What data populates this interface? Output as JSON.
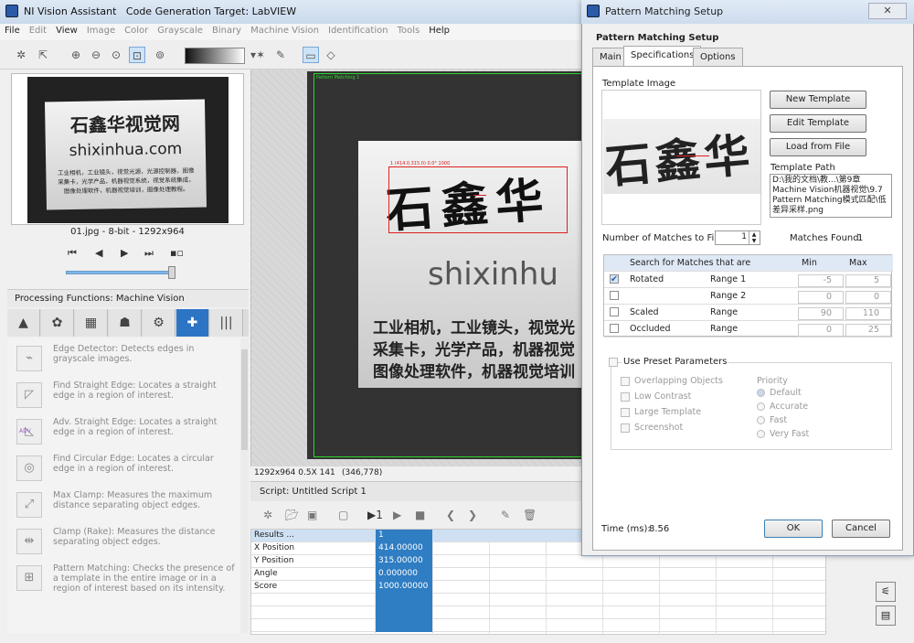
{
  "window": {
    "title": "NI Vision Assistant",
    "subtitle": "Code Generation Target: LabVIEW"
  },
  "menu": [
    {
      "label": "File",
      "dim": false
    },
    {
      "label": "Edit",
      "dim": true
    },
    {
      "label": "View",
      "dim": false
    },
    {
      "label": "Image",
      "dim": true
    },
    {
      "label": "Color",
      "dim": true
    },
    {
      "label": "Grayscale",
      "dim": true
    },
    {
      "label": "Binary",
      "dim": true
    },
    {
      "label": "Machine Vision",
      "dim": true
    },
    {
      "label": "Identification",
      "dim": true
    },
    {
      "label": "Tools",
      "dim": true
    },
    {
      "label": "Help",
      "dim": false
    }
  ],
  "thumbnail": {
    "card_line1": "石鑫华视觉网",
    "card_line2": "shixinhua.com",
    "card_line3": "工业相机，工业镜头，视觉光源，光源控制器，图像",
    "card_line4": "采集卡，光学产品，机器视觉系统，视觉系统集成，",
    "card_line5": "图像处理软件，机器视觉培训，图像处理教程。",
    "info": "01.jpg - 8-bit - 1292x964"
  },
  "processing": {
    "title": "Processing Functions: Machine Vision",
    "items": [
      {
        "title": "Edge Detector:",
        "desc": "Detects edges in grayscale images.",
        "icon": "edge-icon"
      },
      {
        "title": "Find Straight Edge:",
        "desc": "Locates a straight edge in a region of interest.",
        "icon": "straight-edge-icon"
      },
      {
        "title": "Adv. Straight Edge:",
        "desc": "Locates a straight edge in a region of interest.",
        "icon": "adv-edge-icon",
        "badge": "ADV"
      },
      {
        "title": "Find Circular Edge:",
        "desc": "Locates a circular edge in a region of interest.",
        "icon": "circle-edge-icon"
      },
      {
        "title": "Max Clamp:",
        "desc": "Measures the maximum distance separating object edges.",
        "icon": "clamp-icon"
      },
      {
        "title": "Clamp (Rake):",
        "desc": "Measures the distance separating object edges.",
        "icon": "rake-icon"
      },
      {
        "title": "Pattern Matching:",
        "desc": "Checks the presence of a template in the entire image or in a region of interest based on its intensity.",
        "icon": "pattern-icon"
      }
    ]
  },
  "viewer": {
    "roi_label": "Pattern Matching 1",
    "match_label": "1 (414.0,315.0) 0.0° 1000",
    "card_title": "石鑫华",
    "card_url": "shixinhu",
    "card_line1": "工业相机，工业镜头，视觉光",
    "card_line2": "采集卡，光学产品，机器视觉",
    "card_line3": "图像处理软件，机器视觉培训",
    "status_size": "1292x964 0.5X 141",
    "status_coord": "(346,778)"
  },
  "script": {
    "title": "Script: Untitled Script 1",
    "results_label": "Results ...",
    "results_col": "1",
    "rows": [
      {
        "name": "X Position",
        "value": "414.00000"
      },
      {
        "name": "Y Position",
        "value": "315.00000"
      },
      {
        "name": "Angle",
        "value": "0.000000"
      },
      {
        "name": "Score",
        "value": "1000.00000"
      }
    ]
  },
  "dialog": {
    "title": "Pattern Matching Setup",
    "header": "Pattern Matching Setup",
    "tabs": [
      "Main",
      "Specifications",
      "Options"
    ],
    "template_image_label": "Template Image",
    "template_chars": "石鑫华",
    "buttons": {
      "new": "New Template",
      "edit": "Edit Template",
      "load": "Load from File",
      "ok": "OK",
      "cancel": "Cancel"
    },
    "template_path_label": "Template Path",
    "template_path": "D:\\我的文档\\教...\\第9章 Machine Vision机器视觉\\9.7 Pattern Matching模式匹配\\低差异采样.png",
    "num_matches_label": "Number of Matches to Find",
    "num_matches_value": "1",
    "matches_found_label": "Matches Found:",
    "matches_found_value": "1",
    "table_headers": [
      "Search for Matches that are",
      "Min",
      "Max"
    ],
    "table_rows": [
      {
        "checked": true,
        "name": "Rotated",
        "range": "Range 1",
        "min": "-5",
        "max": "5"
      },
      {
        "checked": false,
        "name": "",
        "range": "Range 2",
        "min": "0",
        "max": "0"
      },
      {
        "checked": false,
        "name": "Scaled",
        "range": "Range",
        "min": "90",
        "max": "110"
      },
      {
        "checked": false,
        "name": "Occluded",
        "range": "Range",
        "min": "0",
        "max": "25"
      }
    ],
    "preset_label": "Use Preset Parameters",
    "preset_left": [
      "Overlapping Objects",
      "Low Contrast",
      "Large Template",
      "Screenshot"
    ],
    "priority_label": "Priority",
    "priority_options": [
      "Default",
      "Accurate",
      "Fast",
      "Very Fast"
    ],
    "time_label": "Time (ms):",
    "time_value": "8.56"
  },
  "colors": {
    "accent": "#2f7dc2",
    "roi_green": "#2fd22f",
    "match_red": "#e02020"
  }
}
